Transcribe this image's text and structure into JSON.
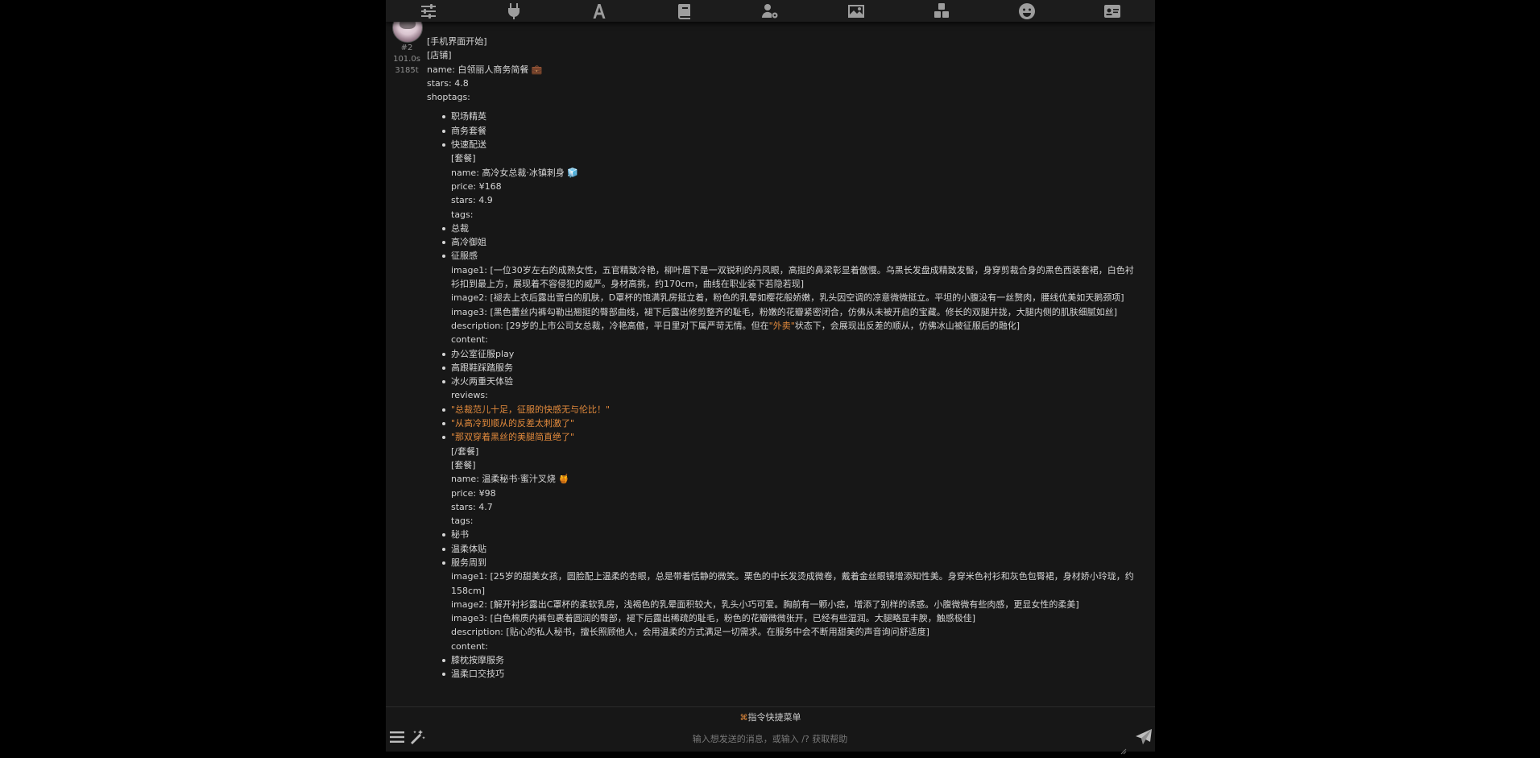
{
  "top_toolbar": {
    "icons": [
      "sliders-icon",
      "plug-icon",
      "font-icon",
      "book-icon",
      "user-gear-icon",
      "image-icon",
      "cubes-icon",
      "smile-icon",
      "id-card-icon"
    ]
  },
  "message": {
    "id": "#2",
    "time": "101.0s",
    "tokens": "3185t",
    "lines_top": [
      "[手机界面开始]",
      "[店铺]",
      "name: 白领丽人商务简餐 💼",
      "stars: 4.8",
      "shoptags:"
    ],
    "shoptags": [
      "职场精英",
      "商务套餐",
      "快速配送"
    ],
    "dish1": {
      "open": "[套餐]",
      "name": "name: 高冷女总裁·冰镇刺身 🧊",
      "price": "price: ¥168",
      "stars": "stars: 4.9",
      "tags_label": "tags:",
      "tags": [
        "总裁",
        "高冷御姐",
        "征服感"
      ],
      "image1": "image1: [一位30岁左右的成熟女性，五官精致冷艳，柳叶眉下是一双锐利的丹凤眼，高挺的鼻梁彰显着傲慢。乌黑长发盘成精致发髻，身穿剪裁合身的黑色西装套裙，白色衬衫扣到最上方，展现着不容侵犯的威严。身材高挑，约170cm，曲线在职业装下若隐若现]",
      "image2": "image2: [褪去上衣后露出雪白的肌肤，D罩杯的饱满乳房挺立着，粉色的乳晕如樱花般娇嫩，乳头因空调的凉意微微挺立。平坦的小腹没有一丝赘肉，腰线优美如天鹅颈项]",
      "image3": "image3: [黑色蕾丝内裤勾勒出翘挺的臀部曲线，褪下后露出修剪整齐的耻毛，粉嫩的花瓣紧密闭合，仿佛从未被开启的宝藏。修长的双腿并拢，大腿内侧的肌肤细腻如丝]",
      "description_pre": "description: [29岁的上市公司女总裁，冷艳高傲，平日里对下属严苛无情。但在",
      "description_hl": "\"外卖\"",
      "description_post": "状态下，会展现出反差的顺从，仿佛冰山被征服后的融化]",
      "content_label": "content:",
      "content": [
        "办公室征服play",
        "高跟鞋踩踏服务",
        "冰火两重天体验"
      ],
      "reviews_label": "reviews:",
      "reviews": [
        "\"总裁范儿十足，征服的快感无与伦比！\"",
        "\"从高冷到顺从的反差太刺激了\"",
        "\"那双穿着黑丝的美腿简直绝了\""
      ],
      "close": "[/套餐]"
    },
    "dish2": {
      "open": "[套餐]",
      "name": "name: 温柔秘书·蜜汁叉烧 🍯",
      "price": "price: ¥98",
      "stars": "stars: 4.7",
      "tags_label": "tags:",
      "tags": [
        "秘书",
        "温柔体贴",
        "服务周到"
      ],
      "image1": "image1: [25岁的甜美女孩，圆脸配上温柔的杏眼，总是带着恬静的微笑。栗色的中长发烫成微卷，戴着金丝眼镜增添知性美。身穿米色衬衫和灰色包臀裙，身材娇小玲珑，约158cm]",
      "image2": "image2: [解开衬衫露出C罩杯的柔软乳房，浅褐色的乳晕面积较大，乳头小巧可爱。胸前有一颗小痣，增添了别样的诱惑。小腹微微有些肉感，更显女性的柔美]",
      "image3": "image3: [白色棉质内裤包裹着圆润的臀部，褪下后露出稀疏的耻毛，粉色的花瓣微微张开，已经有些湿润。大腿略显丰腴，触感极佳]",
      "description": "description: [贴心的私人秘书，擅长照顾他人，会用温柔的方式满足一切需求。在服务中会不断用甜美的声音询问舒适度]",
      "content_label": "content:",
      "content": [
        "膝枕按摩服务",
        "温柔口交技巧"
      ]
    }
  },
  "input": {
    "quick_menu_label": "指令快捷菜单",
    "placeholder": "输入想发送的消息，或输入 /? 获取帮助"
  }
}
